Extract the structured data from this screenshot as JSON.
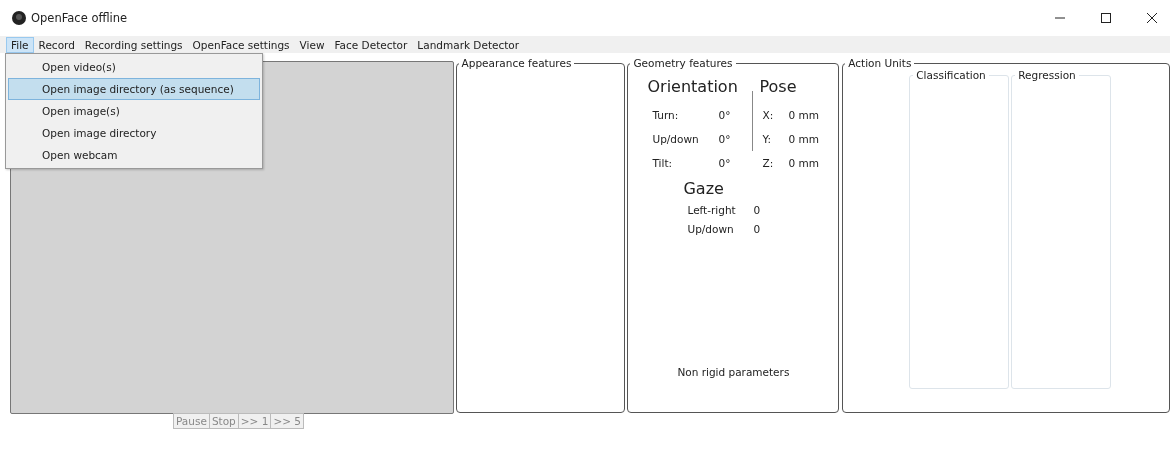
{
  "window": {
    "title": "OpenFace offline"
  },
  "menu_bar": [
    {
      "label": "File",
      "selected": true
    },
    {
      "label": "Record",
      "selected": false
    },
    {
      "label": "Recording settings",
      "selected": false
    },
    {
      "label": "OpenFace settings",
      "selected": false
    },
    {
      "label": "View",
      "selected": false
    },
    {
      "label": "Face Detector",
      "selected": false
    },
    {
      "label": "Landmark Detector",
      "selected": false
    }
  ],
  "file_menu": [
    {
      "label": "Open video(s)",
      "selected": false
    },
    {
      "label": "Open image directory (as sequence)",
      "selected": true
    },
    {
      "label": "Open image(s)",
      "selected": false
    },
    {
      "label": "Open image directory",
      "selected": false
    },
    {
      "label": "Open webcam",
      "selected": false
    }
  ],
  "playback_buttons": [
    {
      "label": "Pause",
      "disabled": true
    },
    {
      "label": "Stop",
      "disabled": true
    },
    {
      "label": ">> 1",
      "disabled": true
    },
    {
      "label": ">> 5",
      "disabled": true
    }
  ],
  "appearance_features": {
    "title": "Appearance features"
  },
  "geometry_features": {
    "title": "Geometry features",
    "orientation": {
      "heading": "Orientation",
      "rows": [
        {
          "label": "Turn:",
          "value": "0°"
        },
        {
          "label": "Up/down",
          "value": "0°"
        },
        {
          "label": "Tilt:",
          "value": "0°"
        }
      ]
    },
    "pose": {
      "heading": "Pose",
      "rows": [
        {
          "label": "X:",
          "value": "0 mm"
        },
        {
          "label": "Y:",
          "value": "0 mm"
        },
        {
          "label": "Z:",
          "value": "0 mm"
        }
      ]
    },
    "gaze": {
      "heading": "Gaze",
      "rows": [
        {
          "label": "Left-right",
          "value": "0"
        },
        {
          "label": "Up/down",
          "value": "0"
        }
      ]
    },
    "non_rigid_label": "Non rigid parameters"
  },
  "action_units": {
    "title": "Action Units",
    "subpanels": [
      {
        "title": "Classification"
      },
      {
        "title": "Regression"
      }
    ]
  }
}
